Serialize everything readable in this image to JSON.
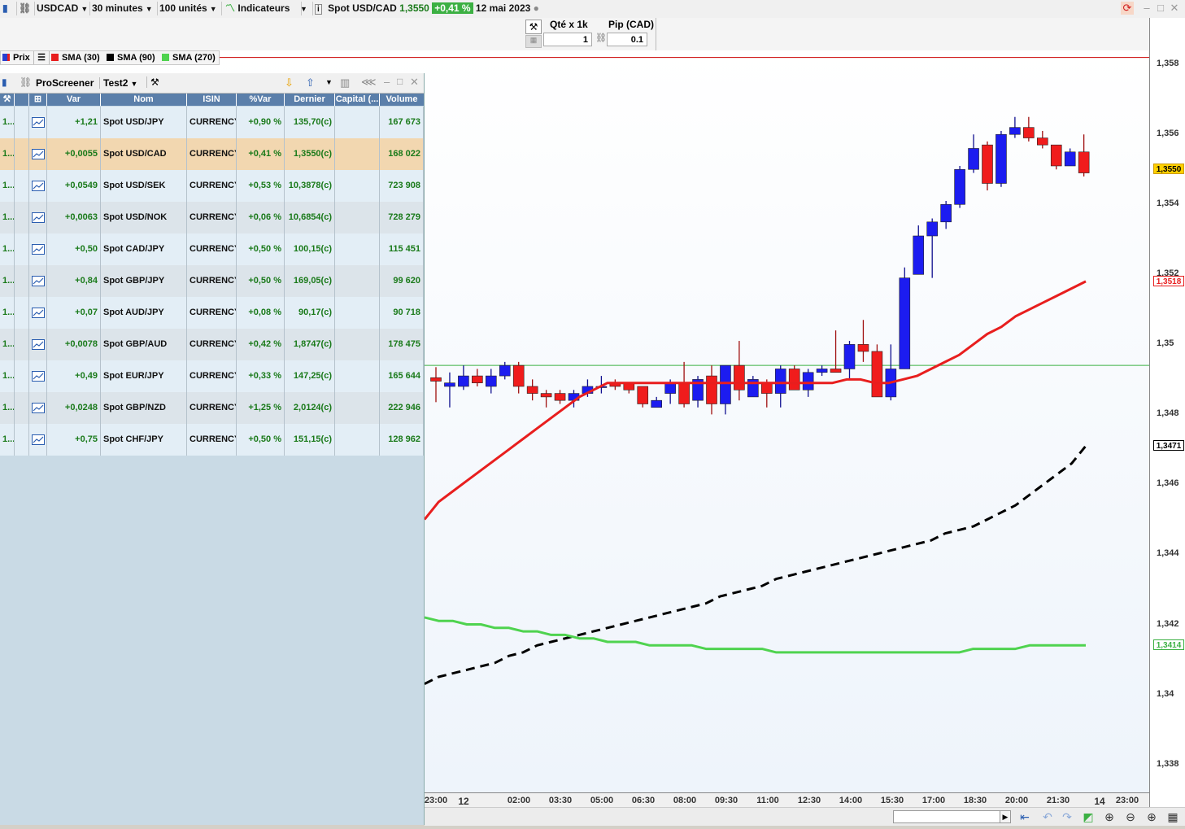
{
  "toolbar": {
    "symbol": "USDCAD",
    "timeframe": "30 minutes",
    "units": "100 unités",
    "indicators": "Indicateurs",
    "instrument_name": "Spot USD/CAD",
    "instrument_price": "1,3550",
    "instrument_change": "+0,41 %",
    "date": "12 mai 2023"
  },
  "order": {
    "qty_label": "Qté x 1k",
    "qty_value": "1",
    "pip_label": "Pip (CAD)",
    "pip_value": "0.1"
  },
  "legend": {
    "items": [
      {
        "label": "Prix",
        "color": "#2a3fd0"
      },
      {
        "label": "SMA (30)",
        "color": "#e81e1e"
      },
      {
        "label": "SMA (90)",
        "color": "#000000"
      },
      {
        "label": "SMA (270)",
        "color": "#4fd34f"
      }
    ]
  },
  "screener": {
    "title": "ProScreener",
    "preset": "Test2",
    "columns": [
      "Var",
      "Nom",
      "ISIN",
      "%Var",
      "Dernier",
      "Capital (...",
      "Volume"
    ],
    "rows": [
      {
        "prefix": "1...",
        "var": "+1,21",
        "name": "Spot USD/JPY",
        "isin": "CURRENCY",
        "pvar": "+0,90 %",
        "last": "135,70(c)",
        "cap": "",
        "volume": "167 673"
      },
      {
        "prefix": "1...",
        "var": "+0,0055",
        "name": "Spot USD/CAD",
        "isin": "CURRENCY",
        "pvar": "+0,41 %",
        "last": "1,3550(c)",
        "cap": "",
        "volume": "168 022"
      },
      {
        "prefix": "1...",
        "var": "+0,0549",
        "name": "Spot USD/SEK",
        "isin": "CURRENCY",
        "pvar": "+0,53 %",
        "last": "10,3878(c)",
        "cap": "",
        "volume": "723 908"
      },
      {
        "prefix": "1...",
        "var": "+0,0063",
        "name": "Spot USD/NOK",
        "isin": "CURRENCY",
        "pvar": "+0,06 %",
        "last": "10,6854(c)",
        "cap": "",
        "volume": "728 279"
      },
      {
        "prefix": "1...",
        "var": "+0,50",
        "name": "Spot CAD/JPY",
        "isin": "CURRENCY",
        "pvar": "+0,50 %",
        "last": "100,15(c)",
        "cap": "",
        "volume": "115 451"
      },
      {
        "prefix": "1...",
        "var": "+0,84",
        "name": "Spot GBP/JPY",
        "isin": "CURRENCY",
        "pvar": "+0,50 %",
        "last": "169,05(c)",
        "cap": "",
        "volume": "99 620"
      },
      {
        "prefix": "1...",
        "var": "+0,07",
        "name": "Spot AUD/JPY",
        "isin": "CURRENCY",
        "pvar": "+0,08 %",
        "last": "90,17(c)",
        "cap": "",
        "volume": "90 718"
      },
      {
        "prefix": "1...",
        "var": "+0,0078",
        "name": "Spot GBP/AUD",
        "isin": "CURRENCY",
        "pvar": "+0,42 %",
        "last": "1,8747(c)",
        "cap": "",
        "volume": "178 475"
      },
      {
        "prefix": "1...",
        "var": "+0,49",
        "name": "Spot EUR/JPY",
        "isin": "CURRENCY",
        "pvar": "+0,33 %",
        "last": "147,25(c)",
        "cap": "",
        "volume": "165 644"
      },
      {
        "prefix": "1...",
        "var": "+0,0248",
        "name": "Spot GBP/NZD",
        "isin": "CURRENCY",
        "pvar": "+1,25 %",
        "last": "2,0124(c)",
        "cap": "",
        "volume": "222 946"
      },
      {
        "prefix": "1...",
        "var": "+0,75",
        "name": "Spot CHF/JPY",
        "isin": "CURRENCY",
        "pvar": "+0,50 %",
        "last": "151,15(c)",
        "cap": "",
        "volume": "128 962"
      }
    ]
  },
  "price_axis": {
    "ticks": [
      "1,358",
      "1,356",
      "1,354",
      "1,352",
      "1,35",
      "1,348",
      "1,346",
      "1,344",
      "1,342",
      "1,34",
      "1,338"
    ],
    "tags": [
      {
        "label": "1,3550",
        "value": 1.355,
        "bg": "#ffd000",
        "fg": "#000000",
        "border": "#cc9900"
      },
      {
        "label": "1,3518",
        "value": 1.3518,
        "bg": "#ffffff",
        "fg": "#e81e1e",
        "border": "#e81e1e"
      },
      {
        "label": "1,3471",
        "value": 1.3471,
        "bg": "#ffffff",
        "fg": "#000000",
        "border": "#000000"
      },
      {
        "label": "1,3414",
        "value": 1.3414,
        "bg": "#ffffff",
        "fg": "#3cb043",
        "border": "#3cb043"
      }
    ]
  },
  "time_axis": {
    "ticks": [
      "23:00",
      "12",
      "02:00",
      "03:30",
      "05:00",
      "06:30",
      "08:00",
      "09:30",
      "11:00",
      "12:30",
      "14:00",
      "15:30",
      "17:00",
      "18:30",
      "20:00",
      "21:30",
      "14",
      "23:00"
    ]
  },
  "chart_data": {
    "type": "candlestick",
    "title": "Spot USD/CAD",
    "ylim": [
      1.3372,
      1.3584
    ],
    "hlines": [
      {
        "value": 1.3582,
        "color": "#cc0000"
      },
      {
        "value": 1.3494,
        "color": "#3cb043"
      }
    ],
    "candles": [
      {
        "o": 1.34905,
        "h": 1.34935,
        "l": 1.34835,
        "c": 1.34895
      },
      {
        "o": 1.3488,
        "h": 1.3492,
        "l": 1.3482,
        "c": 1.3489
      },
      {
        "o": 1.3488,
        "h": 1.3494,
        "l": 1.3487,
        "c": 1.3491
      },
      {
        "o": 1.3491,
        "h": 1.3493,
        "l": 1.3488,
        "c": 1.3489
      },
      {
        "o": 1.3488,
        "h": 1.3493,
        "l": 1.3486,
        "c": 1.3491
      },
      {
        "o": 1.3491,
        "h": 1.3495,
        "l": 1.349,
        "c": 1.3494
      },
      {
        "o": 1.3494,
        "h": 1.3495,
        "l": 1.3486,
        "c": 1.3488
      },
      {
        "o": 1.3488,
        "h": 1.349,
        "l": 1.3484,
        "c": 1.3486
      },
      {
        "o": 1.3486,
        "h": 1.3487,
        "l": 1.3482,
        "c": 1.3485
      },
      {
        "o": 1.3486,
        "h": 1.3487,
        "l": 1.3483,
        "c": 1.3484
      },
      {
        "o": 1.3484,
        "h": 1.3487,
        "l": 1.3482,
        "c": 1.3486
      },
      {
        "o": 1.3486,
        "h": 1.349,
        "l": 1.3485,
        "c": 1.3488
      },
      {
        "o": 1.3488,
        "h": 1.3491,
        "l": 1.3486,
        "c": 1.3488
      },
      {
        "o": 1.3489,
        "h": 1.349,
        "l": 1.3487,
        "c": 1.3488
      },
      {
        "o": 1.3489,
        "h": 1.3489,
        "l": 1.3486,
        "c": 1.3487
      },
      {
        "o": 1.3488,
        "h": 1.3488,
        "l": 1.3482,
        "c": 1.3483
      },
      {
        "o": 1.3482,
        "h": 1.3485,
        "l": 1.3482,
        "c": 1.3484
      },
      {
        "o": 1.3486,
        "h": 1.349,
        "l": 1.3483,
        "c": 1.3489
      },
      {
        "o": 1.3489,
        "h": 1.3495,
        "l": 1.3482,
        "c": 1.3483
      },
      {
        "o": 1.3484,
        "h": 1.3491,
        "l": 1.3482,
        "c": 1.349
      },
      {
        "o": 1.3491,
        "h": 1.3494,
        "l": 1.348,
        "c": 1.3483
      },
      {
        "o": 1.3483,
        "h": 1.3494,
        "l": 1.348,
        "c": 1.3494
      },
      {
        "o": 1.3494,
        "h": 1.3501,
        "l": 1.3484,
        "c": 1.3487
      },
      {
        "o": 1.3485,
        "h": 1.3491,
        "l": 1.3485,
        "c": 1.349
      },
      {
        "o": 1.3489,
        "h": 1.349,
        "l": 1.3482,
        "c": 1.3486
      },
      {
        "o": 1.3486,
        "h": 1.3494,
        "l": 1.3482,
        "c": 1.3493
      },
      {
        "o": 1.3493,
        "h": 1.3494,
        "l": 1.3487,
        "c": 1.3487
      },
      {
        "o": 1.3487,
        "h": 1.3493,
        "l": 1.3485,
        "c": 1.3492
      },
      {
        "o": 1.3492,
        "h": 1.3494,
        "l": 1.3491,
        "c": 1.3493
      },
      {
        "o": 1.3493,
        "h": 1.3504,
        "l": 1.3492,
        "c": 1.3492
      },
      {
        "o": 1.3493,
        "h": 1.3501,
        "l": 1.349,
        "c": 1.35
      },
      {
        "o": 1.35,
        "h": 1.3507,
        "l": 1.3495,
        "c": 1.3498
      },
      {
        "o": 1.3498,
        "h": 1.35,
        "l": 1.3485,
        "c": 1.3485
      },
      {
        "o": 1.3485,
        "h": 1.35,
        "l": 1.3484,
        "c": 1.3493
      },
      {
        "o": 1.3493,
        "h": 1.3522,
        "l": 1.3493,
        "c": 1.3519
      },
      {
        "o": 1.352,
        "h": 1.3534,
        "l": 1.352,
        "c": 1.3531
      },
      {
        "o": 1.3531,
        "h": 1.3536,
        "l": 1.3519,
        "c": 1.3535
      },
      {
        "o": 1.3535,
        "h": 1.3541,
        "l": 1.3533,
        "c": 1.354
      },
      {
        "o": 1.354,
        "h": 1.3551,
        "l": 1.3539,
        "c": 1.355
      },
      {
        "o": 1.355,
        "h": 1.356,
        "l": 1.3549,
        "c": 1.3556
      },
      {
        "o": 1.3557,
        "h": 1.3558,
        "l": 1.3544,
        "c": 1.3546
      },
      {
        "o": 1.3546,
        "h": 1.3561,
        "l": 1.3545,
        "c": 1.356
      },
      {
        "o": 1.356,
        "h": 1.3565,
        "l": 1.3559,
        "c": 1.3562
      },
      {
        "o": 1.3562,
        "h": 1.3565,
        "l": 1.3558,
        "c": 1.3559
      },
      {
        "o": 1.3559,
        "h": 1.3561,
        "l": 1.3556,
        "c": 1.3557
      },
      {
        "o": 1.3557,
        "h": 1.3557,
        "l": 1.355,
        "c": 1.3551
      },
      {
        "o": 1.3551,
        "h": 1.3556,
        "l": 1.3551,
        "c": 1.3555
      },
      {
        "o": 1.3555,
        "h": 1.356,
        "l": 1.3548,
        "c": 1.3549
      }
    ],
    "series": [
      {
        "name": "SMA (30)",
        "color": "#e81e1e",
        "dash": false,
        "values": [
          1.345,
          1.3455,
          1.3458,
          1.3461,
          1.3464,
          1.3467,
          1.347,
          1.3473,
          1.3476,
          1.3479,
          1.3482,
          1.3485,
          1.3487,
          1.3489,
          1.3489,
          1.3489,
          1.3489,
          1.3489,
          1.3489,
          1.3489,
          1.3489,
          1.3489,
          1.3489,
          1.3489,
          1.3489,
          1.3489,
          1.3489,
          1.3489,
          1.3489,
          1.3489,
          1.349,
          1.349,
          1.3489,
          1.3489,
          1.349,
          1.3491,
          1.3493,
          1.3495,
          1.3497,
          1.35,
          1.3503,
          1.3505,
          1.3508,
          1.351,
          1.3512,
          1.3514,
          1.3516,
          1.3518
        ]
      },
      {
        "name": "SMA (90)",
        "color": "#000000",
        "dash": true,
        "values": [
          1.3403,
          1.3405,
          1.3406,
          1.3407,
          1.3408,
          1.3409,
          1.3411,
          1.3412,
          1.3414,
          1.3415,
          1.3416,
          1.3417,
          1.3418,
          1.3419,
          1.342,
          1.3421,
          1.3422,
          1.3423,
          1.3424,
          1.3425,
          1.3426,
          1.3428,
          1.3429,
          1.343,
          1.3431,
          1.3433,
          1.3434,
          1.3435,
          1.3436,
          1.3437,
          1.3438,
          1.3439,
          1.344,
          1.3441,
          1.3442,
          1.3443,
          1.3444,
          1.3446,
          1.3447,
          1.3448,
          1.345,
          1.3452,
          1.3454,
          1.3457,
          1.346,
          1.3463,
          1.3466,
          1.3471
        ]
      },
      {
        "name": "SMA (270)",
        "color": "#4fd34f",
        "dash": false,
        "values": [
          1.3422,
          1.3421,
          1.3421,
          1.342,
          1.342,
          1.3419,
          1.3419,
          1.3418,
          1.3418,
          1.3417,
          1.3417,
          1.3416,
          1.3416,
          1.3415,
          1.3415,
          1.3415,
          1.3414,
          1.3414,
          1.3414,
          1.3414,
          1.3413,
          1.3413,
          1.3413,
          1.3413,
          1.3413,
          1.3412,
          1.3412,
          1.3412,
          1.3412,
          1.3412,
          1.3412,
          1.3412,
          1.3412,
          1.3412,
          1.3412,
          1.3412,
          1.3412,
          1.3412,
          1.3412,
          1.3413,
          1.3413,
          1.3413,
          1.3413,
          1.3414,
          1.3414,
          1.3414,
          1.3414,
          1.3414
        ]
      }
    ]
  }
}
